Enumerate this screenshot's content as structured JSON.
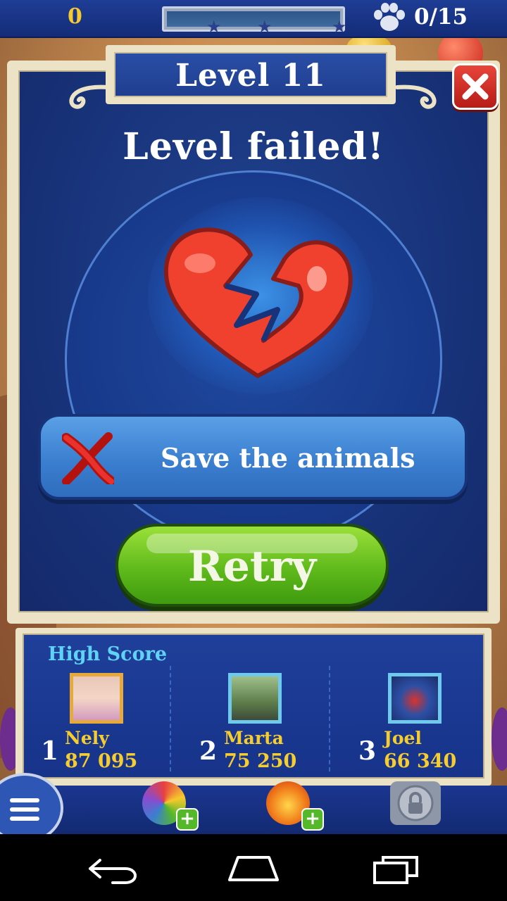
{
  "hud": {
    "score": "0",
    "progress_stars": 3,
    "paw_count": "0/15"
  },
  "dialog": {
    "level_title": "Level 11",
    "status_title": "Level failed!",
    "objective_label": "Save the animals",
    "retry_label": "Retry"
  },
  "high_score": {
    "title": "High Score",
    "entries": [
      {
        "rank": "1",
        "name": "Nely",
        "score": "87 095"
      },
      {
        "rank": "2",
        "name": "Marta",
        "score": "75 250"
      },
      {
        "rank": "3",
        "name": "Joel",
        "score": "66 340"
      }
    ]
  },
  "colors": {
    "panel_blue": "#18337a",
    "gold_text": "#f6cd2e",
    "retry_green": "#5fba1b",
    "close_red": "#d4322a"
  },
  "icons": [
    "paw-icon",
    "close-icon",
    "broken-heart-icon",
    "red-x-icon",
    "menu-icon",
    "lock-icon",
    "back-icon",
    "home-icon",
    "recents-icon"
  ]
}
